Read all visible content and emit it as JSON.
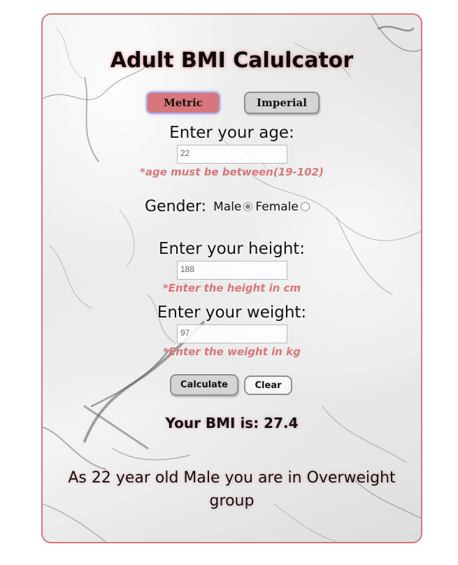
{
  "app": {
    "title": "Adult BMI Calulcator"
  },
  "units": {
    "metric_label": "Metric",
    "imperial_label": "Imperial",
    "selected": "Metric"
  },
  "age": {
    "label": "Enter your age:",
    "value": "22",
    "hint": "*age must be between(19-102)"
  },
  "gender": {
    "label": "Gender:",
    "options": [
      "Male",
      "Female"
    ],
    "selected": "Male"
  },
  "height": {
    "label": "Enter your height:",
    "value": "188",
    "hint": "*Enter the height in cm"
  },
  "weight": {
    "label": "Enter your weight:",
    "value": "97",
    "hint": "*Enter the weight in kg"
  },
  "actions": {
    "calculate_label": "Calculate",
    "clear_label": "Clear"
  },
  "result": {
    "bmi_text": "Your BMI is: 27.4",
    "group_text": "As 22 year old Male you are in Overweight group"
  },
  "colors": {
    "accent": "#d9767a",
    "button_gray": "#d4d4d4",
    "text": "#111111"
  }
}
